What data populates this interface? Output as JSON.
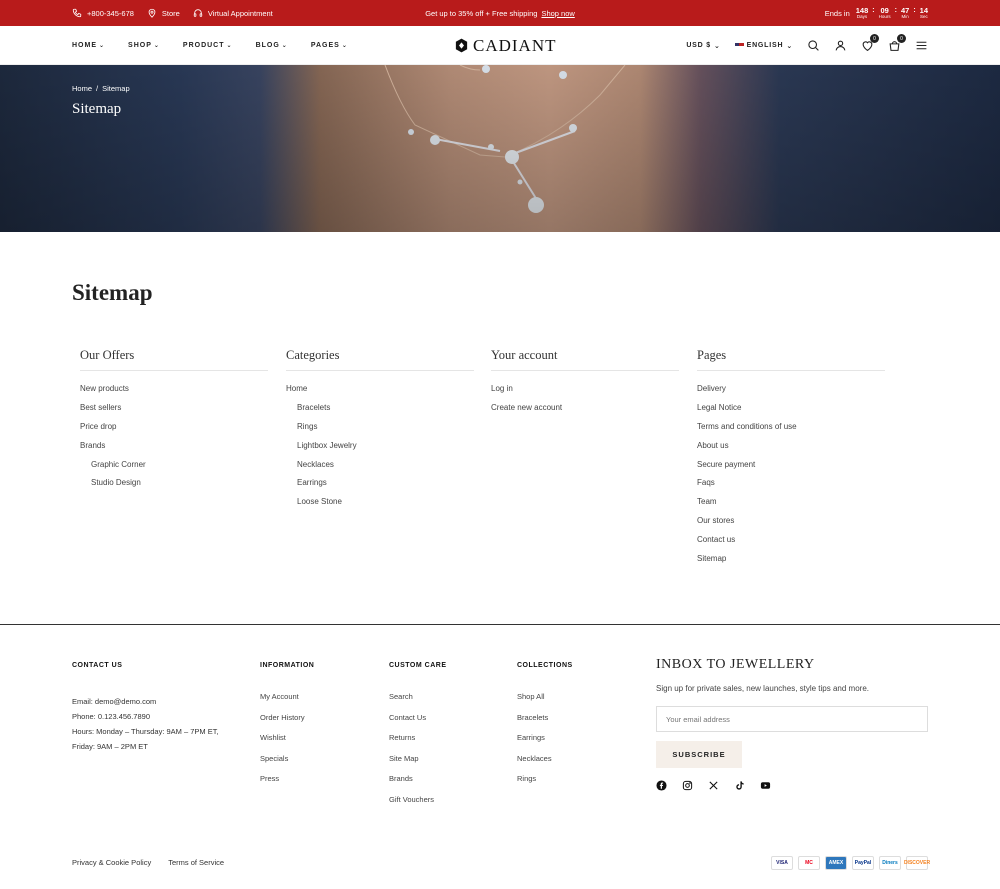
{
  "topbar": {
    "phone": "+800-345-678",
    "store": "Store",
    "virtual": "Virtual Appointment",
    "promo": "Get up to 35% off + Free shipping",
    "promo_link": "Shop now",
    "ends_in": "Ends in",
    "countdown": [
      {
        "num": "148",
        "label": "Days"
      },
      {
        "num": "09",
        "label": "Hours"
      },
      {
        "num": "47",
        "label": "Min"
      },
      {
        "num": "14",
        "label": "Sec"
      }
    ]
  },
  "header": {
    "nav": [
      "HOME",
      "SHOP",
      "PRODUCT",
      "BLOG",
      "PAGES"
    ],
    "logo": "CADIANT",
    "currency": "USD $",
    "language": "ENGLISH",
    "wishlist_count": "0",
    "cart_count": "0"
  },
  "hero": {
    "breadcrumb_home": "Home",
    "breadcrumb_sep": "/",
    "breadcrumb_current": "Sitemap",
    "title": "Sitemap"
  },
  "sitemap": {
    "title": "Sitemap",
    "columns": [
      {
        "heading": "Our Offers",
        "items": [
          {
            "label": "New products",
            "sub": false
          },
          {
            "label": "Best sellers",
            "sub": false
          },
          {
            "label": "Price drop",
            "sub": false
          },
          {
            "label": "Brands",
            "sub": false
          },
          {
            "label": "Graphic Corner",
            "sub": true
          },
          {
            "label": "Studio Design",
            "sub": true
          }
        ]
      },
      {
        "heading": "Categories",
        "items": [
          {
            "label": "Home",
            "sub": false
          },
          {
            "label": "Bracelets",
            "sub": true
          },
          {
            "label": "Rings",
            "sub": true
          },
          {
            "label": "Lightbox Jewelry",
            "sub": true
          },
          {
            "label": "Necklaces",
            "sub": true
          },
          {
            "label": "Earrings",
            "sub": true
          },
          {
            "label": "Loose Stone",
            "sub": true
          }
        ]
      },
      {
        "heading": "Your account",
        "items": [
          {
            "label": "Log in",
            "sub": false
          },
          {
            "label": "Create new account",
            "sub": false
          }
        ]
      },
      {
        "heading": "Pages",
        "items": [
          {
            "label": "Delivery",
            "sub": false
          },
          {
            "label": "Legal Notice",
            "sub": false
          },
          {
            "label": "Terms and conditions of use",
            "sub": false
          },
          {
            "label": "About us",
            "sub": false
          },
          {
            "label": "Secure payment",
            "sub": false
          },
          {
            "label": "Faqs",
            "sub": false
          },
          {
            "label": "Team",
            "sub": false
          },
          {
            "label": "Our stores",
            "sub": false
          },
          {
            "label": "Contact us",
            "sub": false
          },
          {
            "label": "Sitemap",
            "sub": false
          }
        ]
      }
    ]
  },
  "footer": {
    "contact": {
      "heading": "CONTACT US",
      "email": "Email: demo@demo.com",
      "phone": "Phone: 0.123.456.7890",
      "hours": "Hours: Monday – Thursday: 9AM – 7PM ET, Friday: 9AM – 2PM ET"
    },
    "information": {
      "heading": "INFORMATION",
      "items": [
        "My Account",
        "Order History",
        "Wishlist",
        "Specials",
        "Press"
      ]
    },
    "custom_care": {
      "heading": "CUSTOM CARE",
      "items": [
        "Search",
        "Contact Us",
        "Returns",
        "Site Map",
        "Brands",
        "Gift Vouchers"
      ]
    },
    "collections": {
      "heading": "COLLECTIONS",
      "items": [
        "Shop All",
        "Bracelets",
        "Earrings",
        "Necklaces",
        "Rings"
      ]
    },
    "newsletter": {
      "title": "INBOX TO JEWELLERY",
      "subtitle": "Sign up for private sales, new launches, style tips and more.",
      "placeholder": "Your email address",
      "button": "SUBSCRIBE"
    },
    "socials": [
      "facebook-icon",
      "instagram-icon",
      "x-icon",
      "tiktok-icon",
      "youtube-icon"
    ],
    "bottom_links": [
      "Privacy & Cookie Policy",
      "Terms of Service"
    ],
    "payments": [
      {
        "name": "VISA",
        "bg": "#ffffff",
        "fg": "#1a1f71"
      },
      {
        "name": "MC",
        "bg": "#ffffff",
        "fg": "#eb001b"
      },
      {
        "name": "AMEX",
        "bg": "#2e77bc",
        "fg": "#ffffff"
      },
      {
        "name": "PayPal",
        "bg": "#ffffff",
        "fg": "#003087"
      },
      {
        "name": "Diners",
        "bg": "#ffffff",
        "fg": "#0079be"
      },
      {
        "name": "DISCOVER",
        "bg": "#ffffff",
        "fg": "#f58220"
      }
    ]
  },
  "colors": {
    "accent": "#b81b1b",
    "button_bg": "#f5efe9"
  }
}
